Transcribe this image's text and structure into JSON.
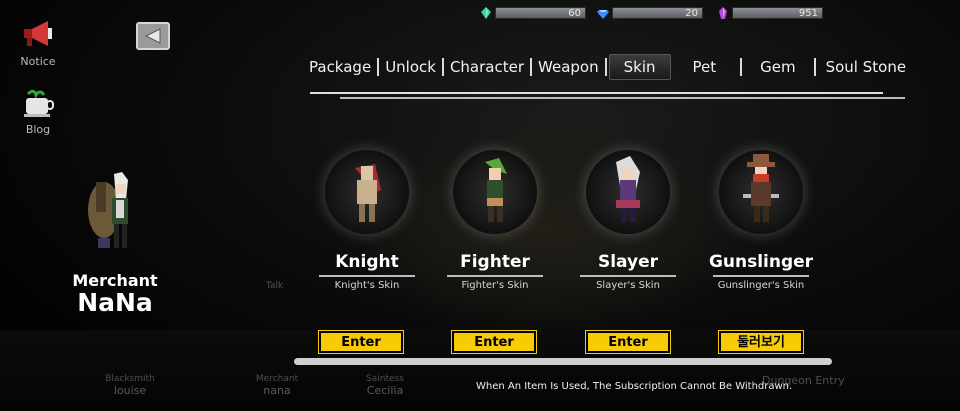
{
  "currencies": [
    {
      "icon": "green-crystal-icon",
      "value": "60",
      "color": "#3fd0a0"
    },
    {
      "icon": "blue-diamond-icon",
      "value": "20",
      "color": "#3c8cff"
    },
    {
      "icon": "purple-crystal-icon",
      "value": "951",
      "color": "#b04ad8"
    }
  ],
  "side": {
    "notice": "Notice",
    "blog": "Blog"
  },
  "tabs": [
    "Package",
    "Unlock",
    "Character",
    "Weapon",
    "Skin",
    "Pet",
    "Gem",
    "Soul Stone"
  ],
  "active_tab": "Skin",
  "merchant": {
    "title": "Merchant",
    "name": "NaNa"
  },
  "skins": [
    {
      "name": "Knight",
      "sub": "Knight's Skin",
      "button": "Enter"
    },
    {
      "name": "Fighter",
      "sub": "Fighter's Skin",
      "button": "Enter"
    },
    {
      "name": "Slayer",
      "sub": "Slayer's Skin",
      "button": "Enter"
    },
    {
      "name": "Gunslinger",
      "sub": "Gunslinger's Skin",
      "button": "둘러보기"
    }
  ],
  "npcs": [
    {
      "role": "Blacksmith",
      "name": "louise"
    },
    {
      "role": "Merchant",
      "name": "nana"
    },
    {
      "role": "Saintess",
      "name": "Cecilia"
    }
  ],
  "talk": "Talk",
  "dungeon": "Dungeon Entry",
  "notice_text": "When An Item Is Used, The Subscription Cannot Be Withdrawn.",
  "accent": "#f7cc05"
}
